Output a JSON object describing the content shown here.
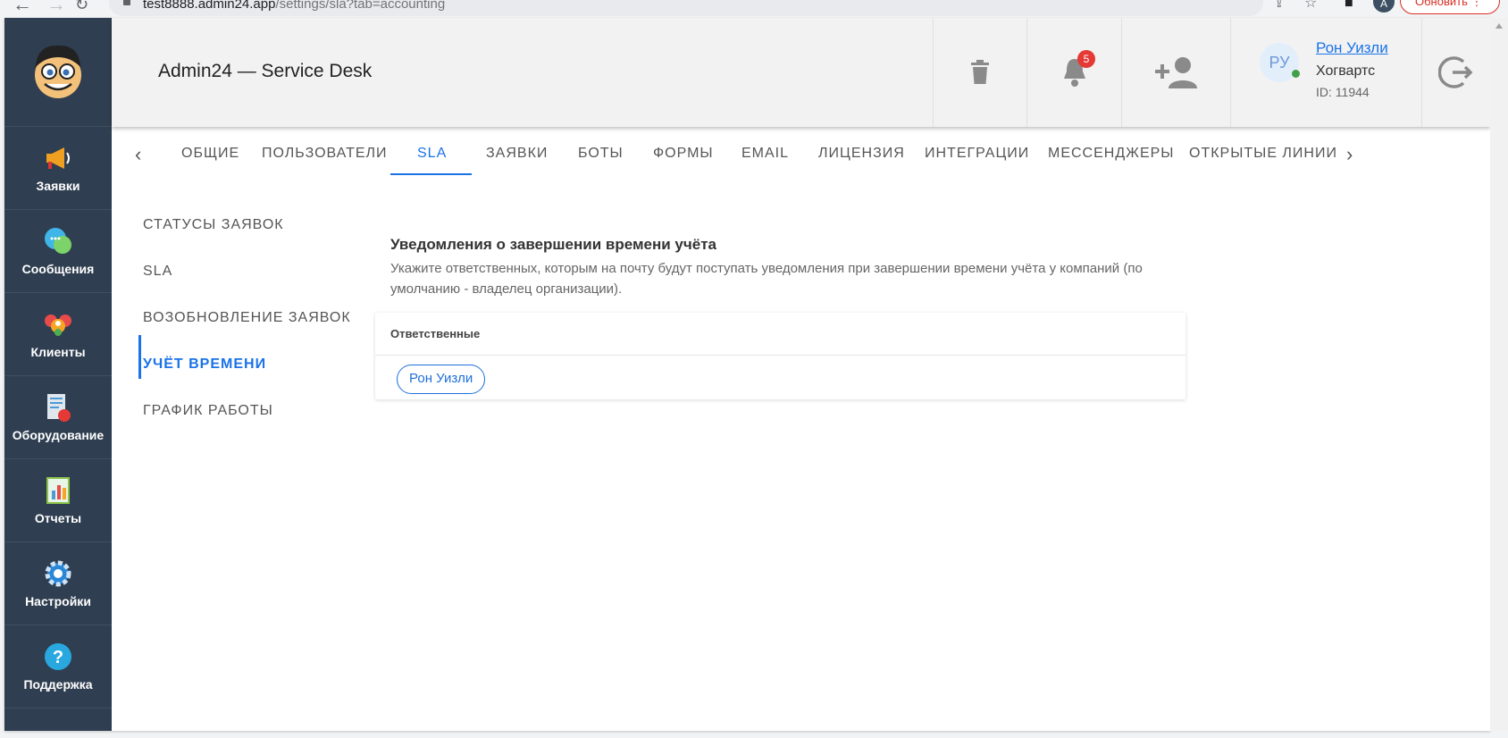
{
  "browser": {
    "url_host": "test8888.admin24.app",
    "url_path": "/settings/sla?tab=accounting",
    "profile_initial": "A",
    "update_label": "Обновить"
  },
  "sidebar": {
    "items": [
      {
        "label": "Заявки",
        "icon": "megaphone-icon"
      },
      {
        "label": "Сообщения",
        "icon": "chat-bubbles-icon"
      },
      {
        "label": "Клиенты",
        "icon": "clients-icon"
      },
      {
        "label": "Оборудование",
        "icon": "equipment-icon"
      },
      {
        "label": "Отчеты",
        "icon": "reports-icon"
      },
      {
        "label": "Настройки",
        "icon": "gear-icon"
      },
      {
        "label": "Поддержка",
        "icon": "help-icon"
      }
    ]
  },
  "header": {
    "title": "Admin24 — Service Desk",
    "notifications_count": "5",
    "user": {
      "initials": "РУ",
      "name": "Рон Уизли",
      "org": "Хогвартс",
      "id": "ID: 11944"
    }
  },
  "tabs": [
    {
      "label": "ОБЩИЕ"
    },
    {
      "label": "ПОЛЬЗОВАТЕЛИ"
    },
    {
      "label": "SLA",
      "active": true
    },
    {
      "label": "ЗАЯВКИ"
    },
    {
      "label": "БОТЫ"
    },
    {
      "label": "ФОРМЫ"
    },
    {
      "label": "EMAIL"
    },
    {
      "label": "ЛИЦЕНЗИЯ"
    },
    {
      "label": "ИНТЕГРАЦИИ"
    },
    {
      "label": "МЕССЕНДЖЕРЫ"
    },
    {
      "label": "ОТКРЫТЫЕ ЛИНИИ"
    }
  ],
  "subnav": [
    {
      "label": "СТАТУСЫ ЗАЯВОК"
    },
    {
      "label": "SLA"
    },
    {
      "label": "ВОЗОБНОВЛЕНИЕ ЗАЯВОК"
    },
    {
      "label": "УЧЁТ ВРЕМЕНИ",
      "active": true
    },
    {
      "label": "ГРАФИК РАБОТЫ"
    }
  ],
  "content": {
    "title": "Уведомления о завершении времени учёта",
    "description": "Укажите ответственных, которым на почту будут поступать уведомления при завершении времени учёта у компаний (по умолчанию - владелец организации).",
    "card_header": "Ответственные",
    "responsible_chip": "Рон Уизли"
  },
  "colors": {
    "sidebar_bg": "#2f3e50",
    "accent": "#1a73e8",
    "badge": "#e53935"
  }
}
